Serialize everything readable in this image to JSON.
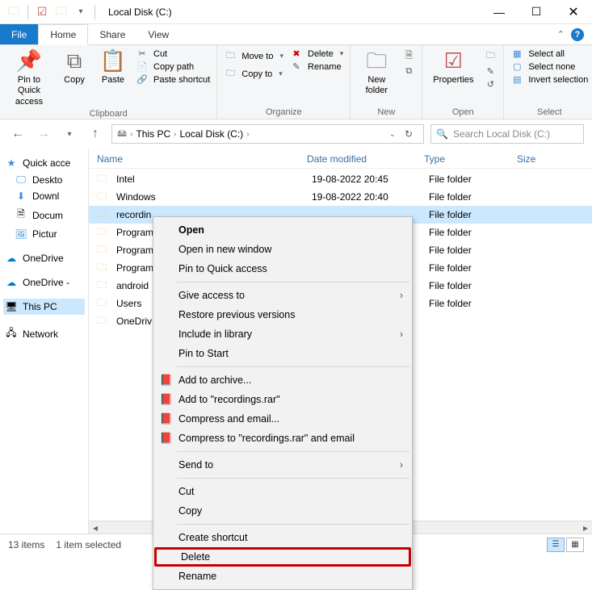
{
  "window": {
    "title": "Local Disk (C:)"
  },
  "tabs": {
    "file": "File",
    "home": "Home",
    "share": "Share",
    "view": "View"
  },
  "ribbon": {
    "clipboard": {
      "pin": "Pin to Quick access",
      "copy": "Copy",
      "paste": "Paste",
      "cut": "Cut",
      "copy_path": "Copy path",
      "paste_shortcut": "Paste shortcut",
      "label": "Clipboard"
    },
    "organize": {
      "move_to": "Move to",
      "copy_to": "Copy to",
      "delete": "Delete",
      "rename": "Rename",
      "label": "Organize"
    },
    "new": {
      "new_folder": "New folder",
      "label": "New"
    },
    "open": {
      "properties": "Properties",
      "label": "Open"
    },
    "select": {
      "select_all": "Select all",
      "select_none": "Select none",
      "invert": "Invert selection",
      "label": "Select"
    }
  },
  "address": {
    "root": "This PC",
    "current": "Local Disk (C:)",
    "search_placeholder": "Search Local Disk (C:)"
  },
  "navpane": {
    "quick": "Quick acce",
    "desktop": "Deskto",
    "downloads": "Downl",
    "documents": "Docum",
    "pictures": "Pictur",
    "onedrive": "OneDrive",
    "onedrive_personal": "OneDrive -",
    "this_pc": "This PC",
    "network": "Network"
  },
  "columns": {
    "name": "Name",
    "date": "Date modified",
    "type": "Type",
    "size": "Size"
  },
  "rows": [
    {
      "name": "Intel",
      "date": "19-08-2022 20:45",
      "type": "File folder"
    },
    {
      "name": "Windows",
      "date": "19-08-2022 20:40",
      "type": "File folder"
    },
    {
      "name": "recordin",
      "date": "",
      "type": "File folder",
      "selected": true
    },
    {
      "name": "Program",
      "date": "",
      "type": "File folder"
    },
    {
      "name": "Program",
      "date": "",
      "type": "File folder"
    },
    {
      "name": "Program",
      "date": "",
      "type": "File folder"
    },
    {
      "name": "android",
      "date": "",
      "type": "File folder"
    },
    {
      "name": "Users",
      "date": "",
      "type": "File folder"
    },
    {
      "name": "OneDriv",
      "date": "",
      "type": ""
    }
  ],
  "context_menu": {
    "open": "Open",
    "open_new_window": "Open in new window",
    "pin_quick": "Pin to Quick access",
    "give_access": "Give access to",
    "restore": "Restore previous versions",
    "include_library": "Include in library",
    "pin_start": "Pin to Start",
    "add_archive": "Add to archive...",
    "add_to_rar": "Add to \"recordings.rar\"",
    "compress_email": "Compress and email...",
    "compress_rar_email": "Compress to \"recordings.rar\" and email",
    "send_to": "Send to",
    "cut": "Cut",
    "copy": "Copy",
    "create_shortcut": "Create shortcut",
    "delete": "Delete",
    "rename": "Rename"
  },
  "status": {
    "items": "13 items",
    "selected": "1 item selected"
  }
}
